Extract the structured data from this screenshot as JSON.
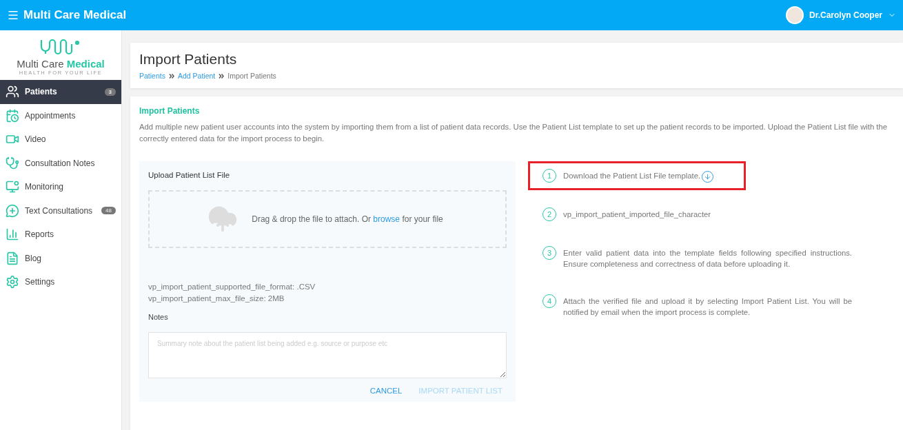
{
  "header": {
    "brand": "Multi Care Medical",
    "user": "Dr.Carolyn Cooper"
  },
  "logo": {
    "name": "Multi Care",
    "accent": "Medical",
    "tagline": "HEALTH FOR YOUR LIFE"
  },
  "nav": [
    {
      "kind": "patients",
      "label": "Patients",
      "selected": true,
      "badge": "3"
    },
    {
      "kind": "appointments",
      "label": "Appointments",
      "selected": false
    },
    {
      "kind": "video",
      "label": "Video",
      "selected": false
    },
    {
      "kind": "notes",
      "label": "Consultation Notes",
      "selected": false
    },
    {
      "kind": "monitoring",
      "label": "Monitoring",
      "selected": false
    },
    {
      "kind": "chat",
      "label": "Text Consultations",
      "selected": false,
      "badge": "48"
    },
    {
      "kind": "reports",
      "label": "Reports",
      "selected": false
    },
    {
      "kind": "blog",
      "label": "Blog",
      "selected": false
    },
    {
      "kind": "settings",
      "label": "Settings",
      "selected": false
    }
  ],
  "page": {
    "title": "Import Patients",
    "breadcrumb": [
      {
        "label": "Patients",
        "kind": "link"
      },
      {
        "label": "Add Patient",
        "kind": "link"
      },
      {
        "label": "Import Patients",
        "kind": "current"
      }
    ]
  },
  "section": {
    "title": "Import Patients",
    "description": "Add multiple new patient user accounts into the system by importing them from a list of patient data records. Use the Patient List template to set up the patient records to be imported. Upload the Patient List file with the correctly entered data for the import process to begin."
  },
  "upload": {
    "title": "Upload Patient List File",
    "drop_before": "Drag & drop the file to attach. Or",
    "drop_link": "browse",
    "drop_after": "for your file",
    "info": [
      "vp_import_patient_supported_file_format: .CSV",
      "vp_import_patient_max_file_size: 2MB"
    ],
    "notes_label": "Notes",
    "notes_placeholder": "Summary note about the patient list being added e.g. source or purpose etc",
    "cancel": "CANCEL",
    "submit": {
      "label": "IMPORT PATIENT LIST",
      "disabled": true
    }
  },
  "steps": [
    {
      "number": "1",
      "text": "Download the Patient List File template.",
      "download": true,
      "highlighted": true
    },
    {
      "number": "2",
      "text": "vp_import_patient_imported_file_character",
      "download": false,
      "highlighted": false
    },
    {
      "number": "3",
      "text": "Enter valid patient data into the template fields following specified instructions. Ensure completeness and correctness of data before uploading it.",
      "download": false,
      "highlighted": false
    },
    {
      "number": "4",
      "text": "Attach the verified file and upload it by selecting Import Patient List. You will be notified by email when the import process is complete.",
      "download": false,
      "highlighted": false
    }
  ]
}
